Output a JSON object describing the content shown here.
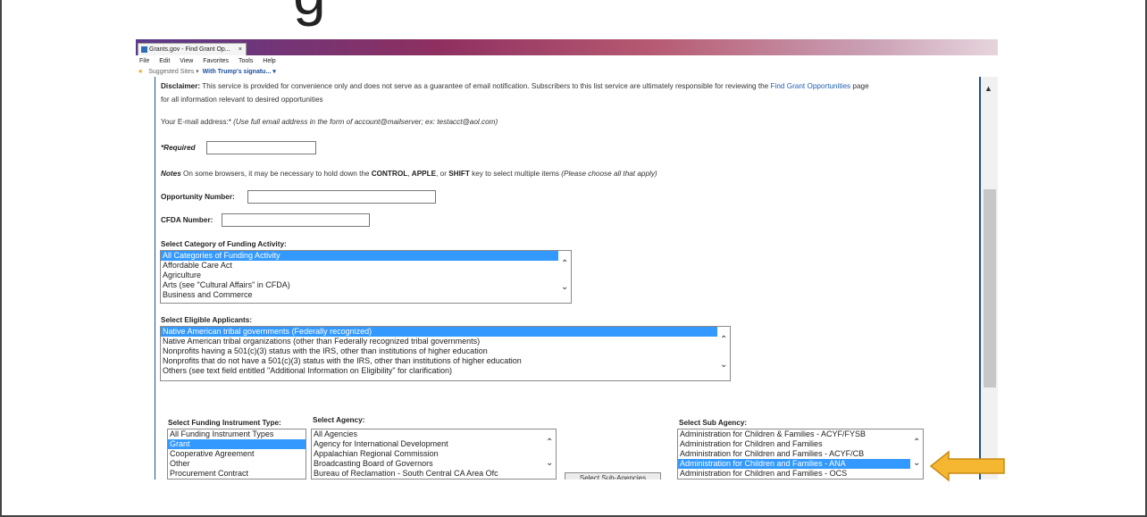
{
  "slide": {
    "heading_fragment": "g"
  },
  "browser": {
    "tab_title": "Grants.gov - Find Grant Op...",
    "tab_close": "×",
    "menu": [
      "File",
      "Edit",
      "View",
      "Favorites",
      "Tools",
      "Help"
    ],
    "favorites": {
      "suggested": "Suggested Sites ▾",
      "trump": "With Trump's signatu... ▾"
    }
  },
  "page": {
    "disclaimer_label": "Disclaimer:",
    "disclaimer_text": " This service is provided for convenience only and does not serve as a guarantee of email notification. Subscribers to this list service are ultimately responsible for reviewing the ",
    "disclaimer_link": "Find Grant Opportunities",
    "disclaimer_tail": " page",
    "disclaimer_line2": "for all information relevant to desired opportunities",
    "email_label": "Your E-mail address:* ",
    "email_hint": "(Use full email address in the form of account@mailserver; ex: testacct@aol.com)",
    "required_label": "*Required",
    "notes_label": "Notes",
    "notes_text_a": " On some browsers, it may be necessary to hold down the ",
    "notes_control": "CONTROL",
    "notes_comma": ", ",
    "notes_apple": "APPLE",
    "notes_or": ", or ",
    "notes_shift": "SHIFT",
    "notes_text_b": " key to select multiple items ",
    "notes_hint": "(Please choose all that apply)",
    "opportunity_label": "Opportunity Number:",
    "cfda_label": "CFDA Number:",
    "category_label": "Select Category of Funding Activity:",
    "category_options": [
      "All Categories of Funding Activity",
      "Affordable Care Act",
      "Agriculture",
      "Arts (see \"Cultural Affairs\" in CFDA)",
      "Business and Commerce"
    ],
    "category_selected": 0,
    "eligible_label": "Select Eligible Applicants:",
    "eligible_options": [
      "Native American tribal governments (Federally recognized)",
      "Native American tribal organizations (other than Federally recognized tribal governments)",
      "Nonprofits having a 501(c)(3) status with the IRS, other than institutions of higher education",
      "Nonprofits that do not have a 501(c)(3) status with the IRS, other than institutions of higher education",
      "Others (see text field entitled \"Additional Information on Eligibility\" for clarification)"
    ],
    "eligible_selected": 0,
    "instrument_label": "Select Funding Instrument Type:",
    "instrument_options": [
      "All Funding Instrument Types",
      "Grant",
      "Cooperative Agreement",
      "Other",
      "Procurement Contract"
    ],
    "instrument_selected": 1,
    "agency_label": "Select Agency:",
    "agency_options": [
      "All Agencies",
      "Agency for International Development",
      "Appalachian Regional Commission",
      "Broadcasting Board of Governors",
      "Bureau of Reclamation - South Central CA Area Ofc"
    ],
    "select_sub_button": "Select Sub-Agencies",
    "subagency_label": "Select Sub Agency:",
    "subagency_options": [
      "Administration for Children & Families - ACYF/FYSB",
      "Administration for Children and Families",
      "Administration for Children and Families - ACYF/CB",
      "Administration for Children and Families - ANA",
      "Administration for Children and Families - OCS"
    ],
    "subagency_selected": 3
  },
  "colors": {
    "selection": "#3399ff",
    "link": "#1f5fb3",
    "arrow_fill": "#f5b731",
    "arrow_stroke": "#c98a12",
    "frame_blue": "#1f4f8f"
  },
  "icons": {
    "scroll_up": "▲",
    "list_up": "⌃",
    "list_down": "⌄"
  }
}
